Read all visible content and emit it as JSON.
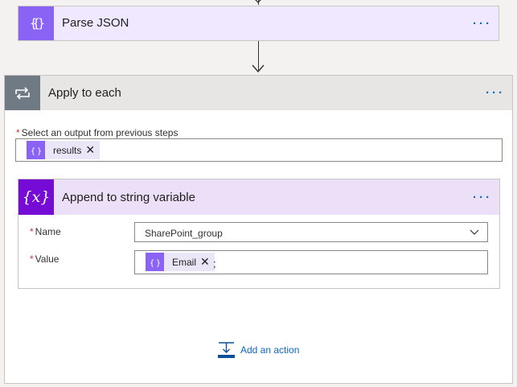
{
  "parse_json": {
    "title": "Parse JSON",
    "icon": "curly-braces-icon",
    "accent": "#8a63f5"
  },
  "apply_to_each": {
    "title": "Apply to each",
    "icon": "loop-icon",
    "accent": "#6f7a85",
    "output_label": "Select an output from previous steps",
    "required_marker": "*",
    "output_token": {
      "label": "results",
      "remove": "✕"
    }
  },
  "append": {
    "title": "Append to string variable",
    "icon_text": "{x}",
    "accent": "#770bd6",
    "name_label": "Name",
    "name_value": "SharePoint_group",
    "value_label": "Value",
    "value_token": {
      "label": "Email",
      "remove": "✕"
    },
    "value_suffix": ";"
  },
  "more_label": "···",
  "add_action": {
    "label": "Add an action"
  }
}
